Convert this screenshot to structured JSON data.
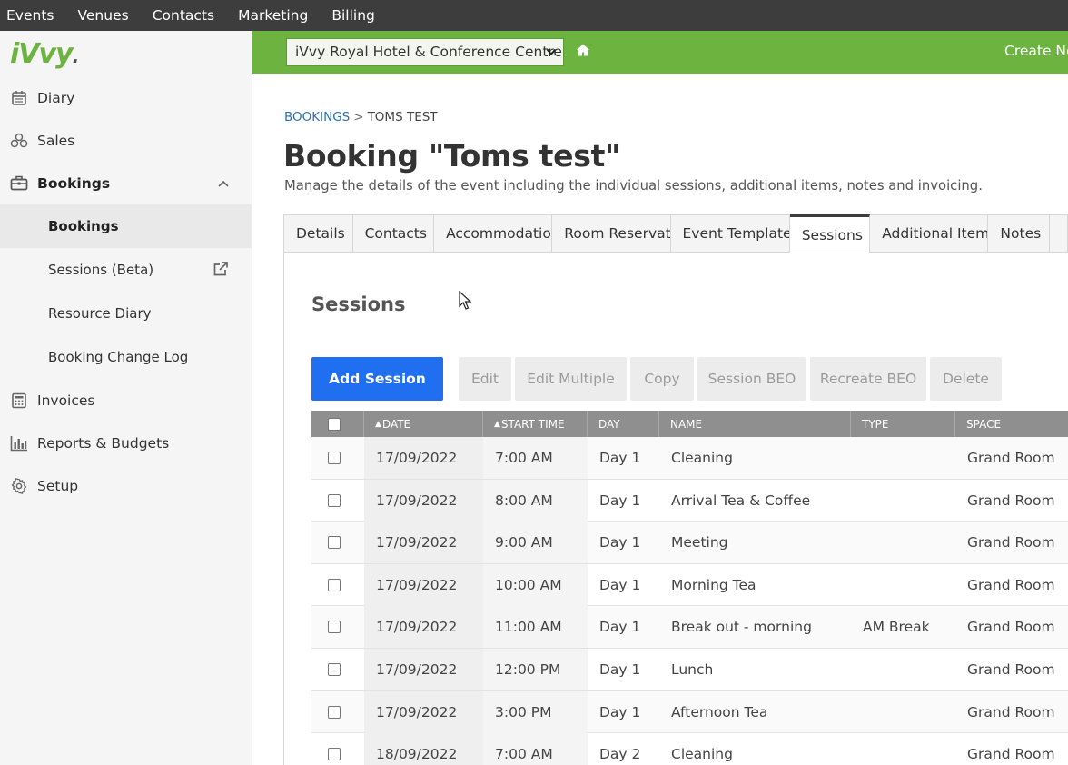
{
  "topmenu": [
    "Events",
    "Venues",
    "Contacts",
    "Marketing",
    "Billing"
  ],
  "logo": {
    "text": "iVvy"
  },
  "sidebar": {
    "items": [
      {
        "label": "Diary",
        "icon": "calendar-icon"
      },
      {
        "label": "Sales",
        "icon": "sales-icon"
      },
      {
        "label": "Bookings",
        "icon": "briefcase-icon"
      }
    ],
    "sub_items": [
      {
        "label": "Bookings"
      },
      {
        "label": "Sessions (Beta)"
      },
      {
        "label": "Resource Diary"
      },
      {
        "label": "Booking Change Log"
      }
    ],
    "items_after": [
      {
        "label": "Invoices",
        "icon": "calculator-icon"
      },
      {
        "label": "Reports & Budgets",
        "icon": "bar-chart-icon"
      },
      {
        "label": "Setup",
        "icon": "gear-icon"
      }
    ]
  },
  "header": {
    "venue": "iVvy Royal Hotel & Conference Centre",
    "create_new": "Create Ne"
  },
  "breadcrumb": {
    "link": "BOOKINGS",
    "separator": ">",
    "current": "TOMS TEST"
  },
  "page": {
    "title": "Booking \"Toms test\"",
    "subtitle": "Manage the details of the event including the individual sessions, additional items, notes and invoicing."
  },
  "tabs": [
    {
      "label": "Details",
      "width": 77
    },
    {
      "label": "Contacts",
      "width": 90
    },
    {
      "label": "Accommodation",
      "width": 131
    },
    {
      "label": "Room Reservatic",
      "width": 131
    },
    {
      "label": "Event Templates",
      "width": 132
    },
    {
      "label": "Sessions",
      "width": 89,
      "active": true
    },
    {
      "label": "Additional Items",
      "width": 131
    },
    {
      "label": "Notes",
      "width": 68
    },
    {
      "label": "",
      "width": 20
    }
  ],
  "section_title": "Sessions",
  "toolbar": {
    "add": "Add Session",
    "buttons": [
      {
        "label": "Edit",
        "width": 58
      },
      {
        "label": "Edit Multiple",
        "width": 123
      },
      {
        "label": "Copy",
        "width": 70
      },
      {
        "label": "Session BEO",
        "width": 120
      },
      {
        "label": "Recreate BEO",
        "width": 128
      },
      {
        "label": "Delete",
        "width": 79
      }
    ]
  },
  "table": {
    "columns": [
      "DATE",
      "START TIME",
      "DAY",
      "NAME",
      "TYPE",
      "SPACE"
    ],
    "rows": [
      {
        "date": "17/09/2022",
        "time": "7:00 AM",
        "day": "Day 1",
        "name": "Cleaning",
        "type": "",
        "space": "Grand Room"
      },
      {
        "date": "17/09/2022",
        "time": "8:00 AM",
        "day": "Day 1",
        "name": "Arrival Tea & Coffee",
        "type": "",
        "space": "Grand Room"
      },
      {
        "date": "17/09/2022",
        "time": "9:00 AM",
        "day": "Day 1",
        "name": "Meeting",
        "type": "",
        "space": "Grand Room"
      },
      {
        "date": "17/09/2022",
        "time": "10:00 AM",
        "day": "Day 1",
        "name": "Morning Tea",
        "type": "",
        "space": "Grand Room"
      },
      {
        "date": "17/09/2022",
        "time": "11:00 AM",
        "day": "Day 1",
        "name": "Break out - morning",
        "type": "AM Break",
        "space": "Grand Room"
      },
      {
        "date": "17/09/2022",
        "time": "12:00 PM",
        "day": "Day 1",
        "name": "Lunch",
        "type": "",
        "space": "Grand Room"
      },
      {
        "date": "17/09/2022",
        "time": "3:00 PM",
        "day": "Day 1",
        "name": "Afternoon Tea",
        "type": "",
        "space": "Grand Room"
      },
      {
        "date": "18/09/2022",
        "time": "7:00 AM",
        "day": "Day 2",
        "name": "Cleaning",
        "type": "",
        "space": "Grand Room"
      }
    ]
  }
}
